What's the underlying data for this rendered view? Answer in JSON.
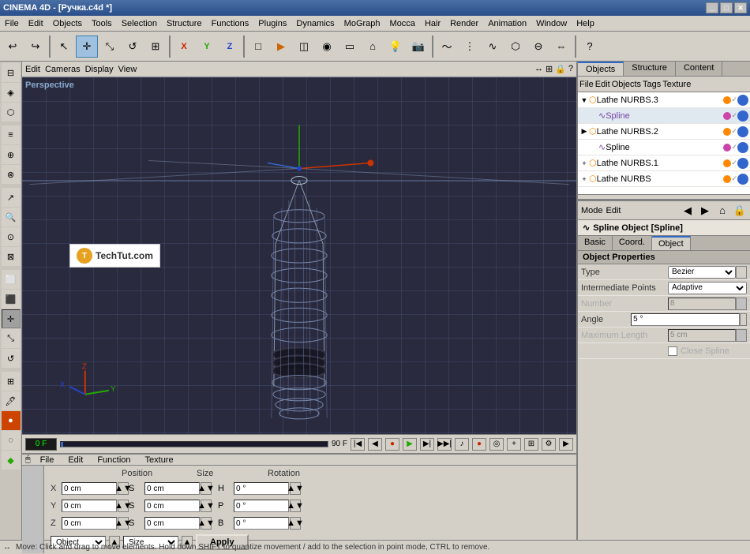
{
  "app": {
    "title": "CINEMA 4D - [Ручка.c4d *]",
    "title_icon": "🎬"
  },
  "menu": {
    "items": [
      "File",
      "Edit",
      "Objects",
      "Tools",
      "Selection",
      "Structure",
      "Functions",
      "Plugins",
      "Dynamics",
      "MoGraph",
      "Mocca",
      "Hair",
      "Render",
      "Animation",
      "Window",
      "Help"
    ]
  },
  "right_panel": {
    "tabs": [
      "Objects",
      "Structure",
      "Content"
    ],
    "active_tab": "Objects",
    "objects_toolbar": [
      "File",
      "Edit",
      "Objects",
      "Tags",
      "Texture"
    ],
    "objects": [
      {
        "name": "Lathe NURBS.3",
        "level": 0,
        "expanded": true,
        "icon": "🔶",
        "color": "#ff8800"
      },
      {
        "name": "Spline",
        "level": 1,
        "expanded": false,
        "icon": "📐",
        "color": "#8844aa"
      },
      {
        "name": "Lathe NURBS.2",
        "level": 0,
        "expanded": false,
        "icon": "🔶",
        "color": "#ff8800"
      },
      {
        "name": "Spline",
        "level": 1,
        "expanded": false,
        "icon": "📐",
        "color": "#8844aa"
      },
      {
        "name": "Lathe NURBS.1",
        "level": 0,
        "expanded": false,
        "icon": "🔶",
        "color": "#ff8800"
      },
      {
        "name": "Lathe NURBS",
        "level": 0,
        "expanded": false,
        "icon": "🔶",
        "color": "#ff8800"
      }
    ]
  },
  "properties": {
    "toolbar_items": [
      "Mode",
      "Edit"
    ],
    "title": "Spline Object [Spline]",
    "tabs": [
      "Basic",
      "Coord.",
      "Object"
    ],
    "active_tab": "Object",
    "section": "Object Properties",
    "rows": [
      {
        "label": "Type",
        "value": "Bezier",
        "type": "dropdown",
        "disabled": false
      },
      {
        "label": "Intermediate Points",
        "value": "Adaptive",
        "type": "dropdown",
        "disabled": false
      },
      {
        "label": "Number",
        "value": "8",
        "type": "number",
        "disabled": true
      },
      {
        "label": "Angle",
        "value": "5 °",
        "type": "number",
        "disabled": false
      },
      {
        "label": "Maximum Length",
        "value": "5 cm",
        "type": "number",
        "disabled": true
      }
    ],
    "close_spline_label": "Close Spline"
  },
  "viewport": {
    "label": "Perspective",
    "toolbar_items": [
      "Edit",
      "Cameras",
      "Display",
      "View"
    ]
  },
  "timeline": {
    "current_frame": "0 F",
    "end_frame": "90 F"
  },
  "bottom_panel": {
    "toolbar_items": [
      "File",
      "Edit",
      "Function",
      "Texture"
    ],
    "headers": {
      "position": "Position",
      "size": "Size",
      "rotation": "Rotation"
    },
    "rows": [
      {
        "axis": "X",
        "pos": "0 cm",
        "size": "0 cm",
        "rot_label": "H",
        "rot": "0 °"
      },
      {
        "axis": "Y",
        "pos": "0 cm",
        "size": "0 cm",
        "rot_label": "P",
        "rot": "0 °"
      },
      {
        "axis": "Z",
        "pos": "0 cm",
        "size": "0 cm",
        "rot_label": "B",
        "rot": "0 °"
      }
    ],
    "object_btn": "Object",
    "size_btn": "Size",
    "apply_btn": "Apply"
  },
  "status_bar": {
    "message": "Move: Click and drag to move elements. Hold down SHIFT to quantize movement / add to the selection in point mode, CTRL to remove."
  }
}
